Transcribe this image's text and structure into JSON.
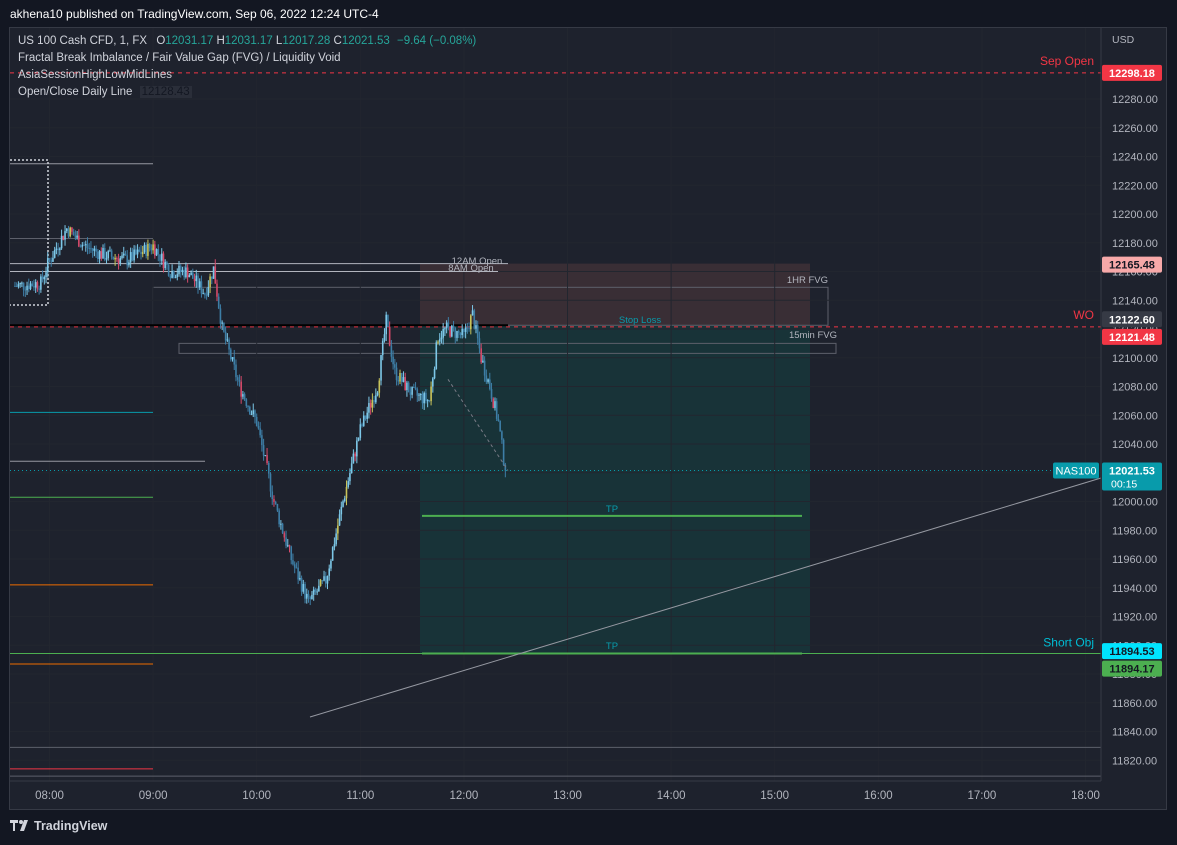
{
  "header": {
    "published": "akhena10 published on TradingView.com, Sep 06, 2022 12:24 UTC-4"
  },
  "legend": {
    "symbol": "US 100 Cash CFD, 1, FX",
    "o_label": "O",
    "o": "12031.17",
    "h_label": "H",
    "h": "12031.17",
    "l_label": "L",
    "l": "12017.28",
    "c_label": "C",
    "c": "12021.53",
    "change": "−9.64 (−0.08%)",
    "ind1": "Fractal Break Imbalance / Fair Value Gap (FVG) / Liquidity Void",
    "ind2": "AsiaSessionHighLowMidLines",
    "ind3": "Open/Close Daily Line",
    "ind3_value": "12128.43"
  },
  "footer": {
    "brand": "TradingView"
  },
  "chart_data": {
    "type": "candlestick",
    "currency": "USD",
    "x_ticks": [
      "08:00",
      "09:00",
      "10:00",
      "11:00",
      "12:00",
      "13:00",
      "14:00",
      "15:00",
      "16:00",
      "17:00",
      "18:00"
    ],
    "y_ticks": [
      11820,
      11840,
      11860,
      11880,
      11900,
      11920,
      11940,
      11960,
      11980,
      12000,
      12020,
      12040,
      12060,
      12080,
      12100,
      12120,
      12140,
      12160,
      12180,
      12200,
      12220,
      12240,
      12260,
      12280
    ],
    "ylim": [
      11808,
      12312
    ],
    "price_path": [
      [
        "07:40",
        12150
      ],
      [
        "07:55",
        12152
      ],
      [
        "07:59",
        12165
      ],
      [
        "08:10",
        12190
      ],
      [
        "08:20",
        12178
      ],
      [
        "08:30",
        12172
      ],
      [
        "08:45",
        12168
      ],
      [
        "09:00",
        12178
      ],
      [
        "09:10",
        12160
      ],
      [
        "09:20",
        12160
      ],
      [
        "09:30",
        12145
      ],
      [
        "09:35",
        12162
      ],
      [
        "09:40",
        12120
      ],
      [
        "09:50",
        12080
      ],
      [
        "10:00",
        12055
      ],
      [
        "10:10",
        12000
      ],
      [
        "10:20",
        11960
      ],
      [
        "10:30",
        11930
      ],
      [
        "10:40",
        11945
      ],
      [
        "10:50",
        12000
      ],
      [
        "11:00",
        12050
      ],
      [
        "11:10",
        12080
      ],
      [
        "11:15",
        12125
      ],
      [
        "11:20",
        12090
      ],
      [
        "11:30",
        12075
      ],
      [
        "11:40",
        12070
      ],
      [
        "11:45",
        12115
      ],
      [
        "11:50",
        12120
      ],
      [
        "12:00",
        12115
      ],
      [
        "12:05",
        12130
      ],
      [
        "12:10",
        12100
      ],
      [
        "12:15",
        12080
      ],
      [
        "12:20",
        12055
      ],
      [
        "12:24",
        12021.53
      ]
    ],
    "price_labels": [
      {
        "label": "Sep Open",
        "value": "12298.18",
        "color": "#f23645"
      },
      {
        "label": "",
        "value": "12165.48",
        "color": "#f7a9a9"
      },
      {
        "label": "",
        "value": "12122.60",
        "color": "#363a45"
      },
      {
        "label": "WO",
        "value": "12121.48",
        "color": "#f23645"
      },
      {
        "label": "NAS100",
        "value": "12021.53",
        "countdown": "00:15",
        "color": "#089bab"
      },
      {
        "label": "",
        "value": "11894.53",
        "color": "#00e5ff"
      },
      {
        "label": "Short Obj",
        "value": "11894.17",
        "color": "#4caf50"
      }
    ],
    "annotations": [
      "12AM Open",
      "8AM Open",
      "1HR FVG",
      "15min FVG",
      "Stop Loss",
      "TP",
      "TP"
    ]
  }
}
